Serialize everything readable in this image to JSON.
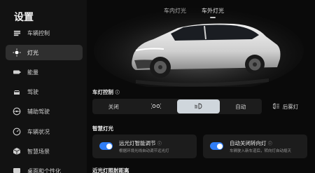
{
  "sidebar": {
    "title": "设置",
    "items": [
      {
        "label": "车辆控制",
        "icon": "car-control-icon",
        "active": false
      },
      {
        "label": "灯光",
        "icon": "light-icon",
        "active": true
      },
      {
        "label": "能量",
        "icon": "battery-icon",
        "active": false
      },
      {
        "label": "驾驶",
        "icon": "drive-car-icon",
        "active": false
      },
      {
        "label": "辅助驾驶",
        "icon": "steering-wheel-icon",
        "active": false
      },
      {
        "label": "车辆状况",
        "icon": "gauge-icon",
        "active": false
      },
      {
        "label": "智慧场景",
        "icon": "cube-icon",
        "active": false
      },
      {
        "label": "桌面和个性化",
        "icon": "desktop-icon",
        "active": false
      }
    ]
  },
  "tabs": [
    {
      "label": "车内灯光",
      "active": false
    },
    {
      "label": "车外灯光",
      "active": true
    }
  ],
  "light_control": {
    "title": "车灯控制",
    "options": [
      {
        "label": "关闭",
        "icon": "",
        "selected": false
      },
      {
        "label": "",
        "icon": "position-light-icon",
        "selected": false
      },
      {
        "label": "",
        "icon": "low-beam-icon",
        "selected": true
      },
      {
        "label": "自动",
        "icon": "",
        "selected": false
      }
    ],
    "rear_fog": {
      "label": "后雾灯",
      "icon": "rear-fog-icon"
    }
  },
  "smart_light": {
    "title": "智慧灯光",
    "cards": [
      {
        "title": "远光灯智能调节",
        "desc": "根据环境光线自动调节远光灯",
        "on": true
      },
      {
        "title": "自动关闭转向灯",
        "desc": "车辆驶入新车道后，转向灯自动熄灭",
        "on": true
      }
    ]
  },
  "bottom_section": {
    "title": "近光灯照射距离"
  },
  "colors": {
    "accent": "#2f7df6",
    "active_bg": "#2f2f2f",
    "selected_seg": "#cfd6dc"
  }
}
